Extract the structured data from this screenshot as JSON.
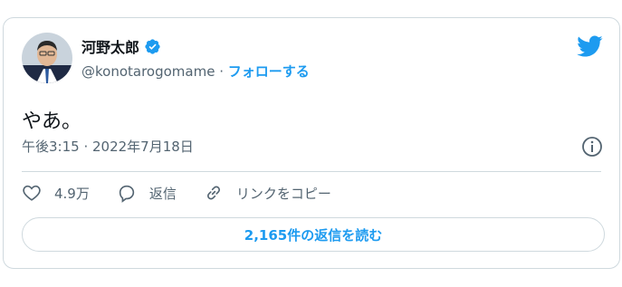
{
  "author": {
    "name": "河野太郎",
    "handle": "@konotarogomame",
    "separator": " · ",
    "follow_label": "フォローする"
  },
  "tweet": {
    "text": "やあ。",
    "time": "午後3:15",
    "date": "2022年7月18日",
    "meta_separator": " · "
  },
  "actions": {
    "likes": "4.9万",
    "reply": "返信",
    "copy_link": "リンクをコピー"
  },
  "replies_button": "2,165件の返信を読む",
  "colors": {
    "accent": "#1d9bf0",
    "muted": "#536471",
    "border": "#cfd9de"
  },
  "icons": [
    "verified-badge-icon",
    "twitter-bird-icon",
    "info-icon",
    "heart-icon",
    "reply-icon",
    "link-icon"
  ]
}
